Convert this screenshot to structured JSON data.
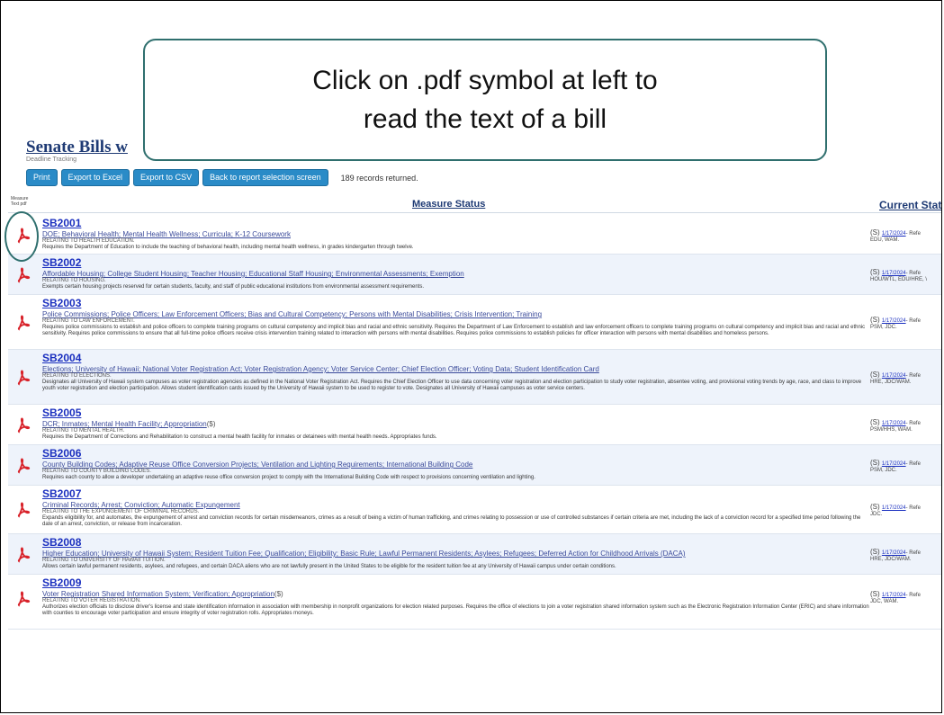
{
  "callout": {
    "line1": "Click on .pdf symbol at left to",
    "line2": "read the text of a bill"
  },
  "report": {
    "title": "Senate Bills w",
    "subtitle": "Deadline Tracking",
    "buttons": [
      "Print",
      "Export to Excel",
      "Export to CSV",
      "Back to report selection screen"
    ],
    "records_text": "189 records returned.",
    "header_left": "Measure Text pdf",
    "header_status": "Measure Status",
    "header_current": "Current Statu"
  },
  "icons": {
    "pdf": "pdf-icon",
    "highlight": "circle-highlight"
  },
  "bills": [
    {
      "no": "SB2001",
      "measure": "DOE; Behavioral Health; Mental Health Wellness; Curricula; K-12 Coursework",
      "relating": "RELATING TO HEALTH EDUCATION.",
      "desc": "Requires the Department of Education to include the teaching of behavioral health, including mental health wellness, in grades kindergarten through twelve.",
      "cur_date": "1/17/2024",
      "cur_text": "- Refe",
      "cur_comm": "EDU, WAM."
    },
    {
      "no": "SB2002",
      "measure": "Affordable Housing; College Student Housing; Teacher Housing; Educational Staff Housing; Environmental Assessments; Exemption",
      "relating": "RELATING TO HOUSING.",
      "desc": "Exempts certain housing projects reserved for certain students, faculty, and staff of public educational institutions from environmental assessment requirements.",
      "cur_date": "1/17/2024",
      "cur_text": "- Refe",
      "cur_comm": "HOU/WTL, EDU/HRE, \\"
    },
    {
      "no": "SB2003",
      "measure": "Police Commissions; Police Officers; Law Enforcement Officers; Bias and Cultural Competency; Persons with Mental Disabilities; Crisis Intervention; Training",
      "relating": "RELATING TO LAW ENFORCEMENT.",
      "desc": "Requires police commissions to establish and police officers to complete training programs on cultural competency and implicit bias and racial and ethnic sensitivity. Requires the Department of Law Enforcement to establish and law enforcement officers to complete training programs on cultural competency and implicit bias and racial and ethnic sensitivity. Requires police commissions to ensure that all full-time police officers receive crisis intervention training related to interaction with persons with mental disabilities. Requires police commissions to establish policies for officer interaction with persons with mental disabilities and homeless persons.",
      "cur_date": "1/17/2024",
      "cur_text": "- Refe",
      "cur_comm": "PSM, JDC."
    },
    {
      "no": "SB2004",
      "measure": "Elections; University of Hawaii; National Voter Registration Act; Voter Registration Agency; Voter Service Center; Chief Election Officer; Voting Data; Student Identification Card",
      "relating": "RELATING TO ELECTIONS.",
      "desc": "Designates all University of Hawaii system campuses as voter registration agencies as defined in the National Voter Registration Act. Requires the Chief Election Officer to use data concerning voter registration and election participation to study voter registration, absentee voting, and provisional voting trends by age, race, and class to improve youth voter registration and election participation. Allows student identification cards issued by the University of Hawaii system to be used to register to vote. Designates all University of Hawaii campuses as voter service centers.",
      "cur_date": "1/17/2024",
      "cur_text": "- Refe",
      "cur_comm": "HRE, JDC/WAM."
    },
    {
      "no": "SB2005",
      "measure": "DCR; Inmates; Mental Health Facility; Appropriation",
      "measure_suffix": " ($)",
      "relating": "RELATING TO MENTAL HEALTH.",
      "desc": "Requires the Department of Corrections and Rehabilitation to construct a mental health facility for inmates or detainees with mental health needs. Appropriates funds.",
      "cur_date": "1/17/2024",
      "cur_text": "- Refe",
      "cur_comm": "PSM/HHS, WAM."
    },
    {
      "no": "SB2006",
      "measure": "County Building Codes; Adaptive Reuse Office Conversion Projects; Ventilation and Lighting Requirements; International Building Code",
      "relating": "RELATING TO COUNTY BUILDING CODES.",
      "desc": "Requires each county to allow a developer undertaking an adaptive reuse office conversion project to comply with the International Building Code with respect to provisions concerning ventilation and lighting.",
      "cur_date": "1/17/2024",
      "cur_text": "- Refe",
      "cur_comm": "PSM, JDC."
    },
    {
      "no": "SB2007",
      "measure": "Criminal Records; Arrest; Conviction; Automatic Expungement",
      "relating": "RELATING TO THE EXPUNGEMENT OF CRIMINAL RECORDS.",
      "desc": "Expands eligibility for, and automates, the expungement of arrest and conviction records for certain misdemeanors, crimes as a result of being a victim of human trafficking, and crimes relating to possession or use of controlled substances if certain criteria are met, including the lack of a conviction record for a specified time period following the date of an arrest, conviction, or release from incarceration.",
      "cur_date": "1/17/2024",
      "cur_text": "- Refe",
      "cur_comm": "JDC."
    },
    {
      "no": "SB2008",
      "measure": "Higher Education; University of Hawaii System; Resident Tuition Fee; Qualification; Eligibility; Basic Rule; Lawful Permanent Residents; Asylees; Refugees; Deferred Action for Childhood Arrivals (DACA)",
      "relating": "RELATING TO UNIVERSITY OF HAWAII TUITION.",
      "desc": "Allows certain lawful permanent residents, asylees, and refugees, and certain DACA aliens who are not lawfully present in the United States to be eligible for the resident tuition fee at any University of Hawaii campus under certain conditions.",
      "cur_date": "1/17/2024",
      "cur_text": "- Refe",
      "cur_comm": "HRE, JDC/WAM."
    },
    {
      "no": "SB2009",
      "measure": "Voter Registration Shared Information System; Verification; Appropriation",
      "measure_suffix": " ($)",
      "relating": "RELATING TO VOTER REGISTRATION.",
      "desc": "Authorizes election officials to disclose driver's license and state identification information in association with membership in nonprofit organizations for election related purposes. Requires the office of elections to join a voter registration shared information system such as the Electronic Registration Information Center (ERIC) and share information with counties to encourage voter participation and ensure integrity of voter registration rolls. Appropriates moneys.",
      "cur_date": "1/17/2024",
      "cur_text": "- Refe",
      "cur_comm": "JDC, WAM."
    }
  ]
}
